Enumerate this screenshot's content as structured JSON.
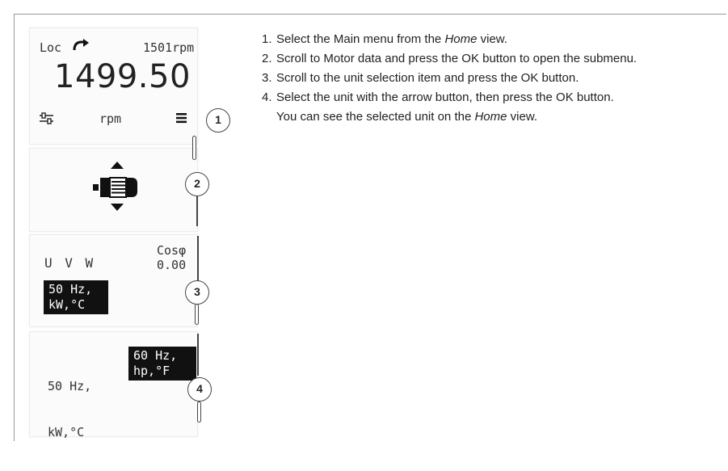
{
  "panel_home": {
    "mode": "Loc",
    "speed_ref": "1501rpm",
    "speed_value": "1499.50",
    "unit": "rpm",
    "callout": "1"
  },
  "panel_menu": {
    "callout": "2"
  },
  "panel_units": {
    "labels": "U V W",
    "cosphi_label": "Cosφ",
    "cosphi_value": "0.00",
    "selected_line1": "50 Hz,",
    "selected_line2": "kW,°C",
    "callout": "3"
  },
  "panel_select": {
    "option1_line1": "50 Hz,",
    "option1_line2": "kW,°C",
    "option2_line1": "60 Hz,",
    "option2_line2": "hp,°F",
    "callout": "4"
  },
  "steps": [
    {
      "num": "1.",
      "before": "Select the Main menu from the ",
      "em": "Home",
      "after": " view."
    },
    {
      "num": "2.",
      "before": "Scroll to Motor data and press the OK button to open the submenu.",
      "em": "",
      "after": ""
    },
    {
      "num": "3.",
      "before": "Scroll to the unit selection item and press the OK button.",
      "em": "",
      "after": ""
    },
    {
      "num": "4.",
      "before": "Select the unit with the arrow button, then press the OK button.",
      "em": "",
      "after": ""
    }
  ],
  "note": {
    "before": "You can see the selected unit on the ",
    "em": "Home",
    "after": " view."
  },
  "icons": [
    "rotate-arrow-icon",
    "settings-sliders-icon",
    "menu-lines-icon",
    "arrow-up-icon",
    "motor-icon",
    "arrow-down-icon"
  ]
}
